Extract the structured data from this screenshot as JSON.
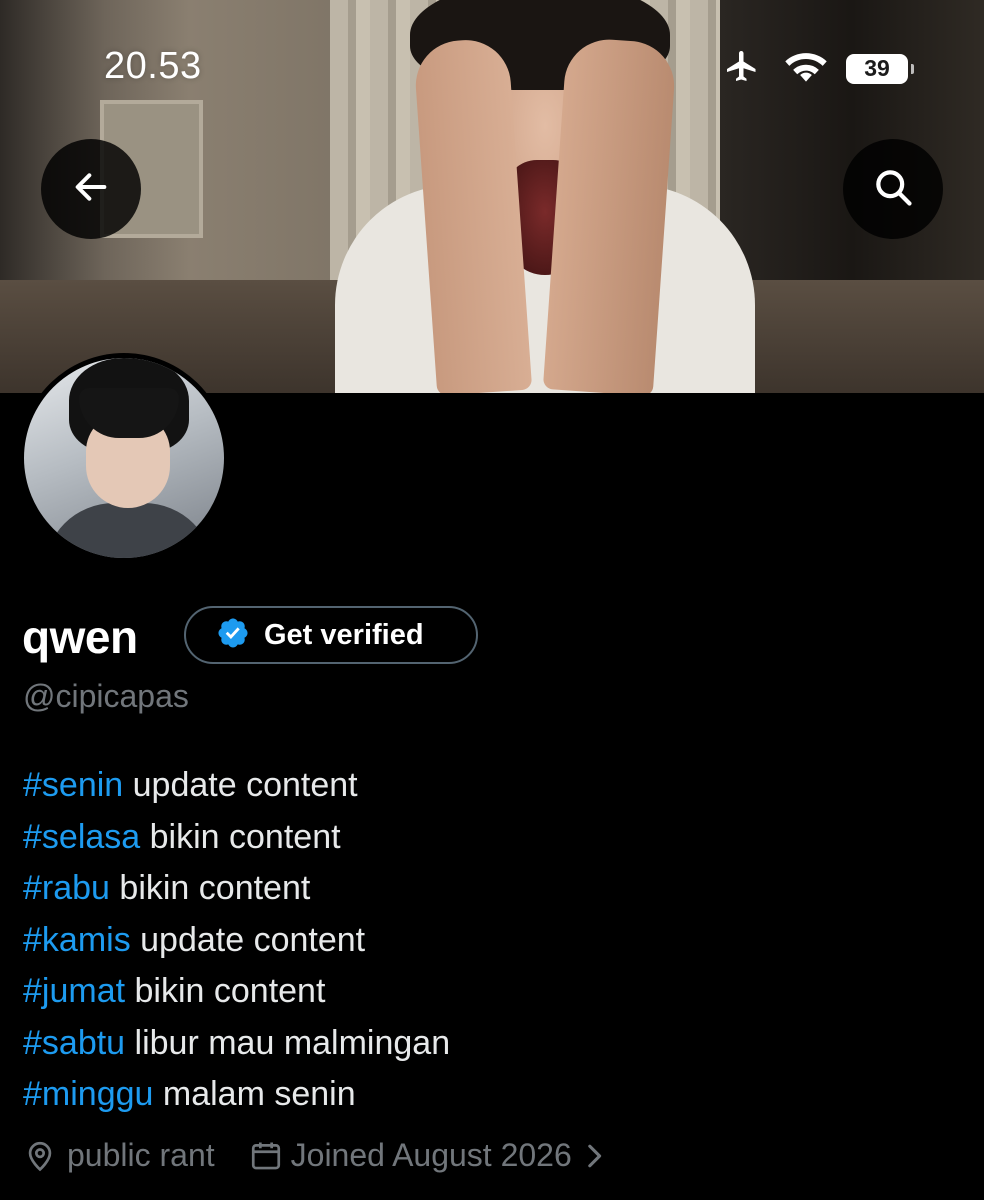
{
  "status_bar": {
    "time": "20.53",
    "battery": "39"
  },
  "profile": {
    "name": "qwen",
    "verify_label": "Get verified",
    "handle": "@cipicapas",
    "bio": [
      {
        "tag": "#senin",
        "text": " update content"
      },
      {
        "tag": "#selasa",
        "text": " bikin content"
      },
      {
        "tag": "#rabu",
        "text": " bikin content"
      },
      {
        "tag": "#kamis",
        "text": " update content"
      },
      {
        "tag": "#jumat",
        "text": " bikin content"
      },
      {
        "tag": "#sabtu",
        "text": " libur mau malmingan"
      },
      {
        "tag": "#minggu",
        "text": " malam senin"
      }
    ],
    "location": "public rant",
    "joined": "Joined August 2026"
  },
  "icons": [
    "back-arrow-icon",
    "search-icon",
    "airplane-icon",
    "wifi-icon",
    "verified-badge-icon",
    "location-pin-icon",
    "calendar-icon",
    "chevron-right-icon"
  ],
  "colors": {
    "link": "#1d9bf0",
    "muted": "#71767b",
    "text": "#e7e9ea",
    "background": "#000000"
  }
}
